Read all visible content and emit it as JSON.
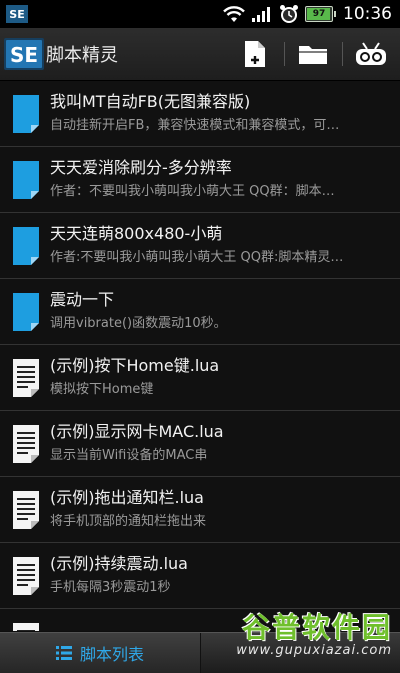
{
  "status_bar": {
    "time": "10:36",
    "battery": "97",
    "battery_level": 0.97
  },
  "action_bar": {
    "logo_text": "SE",
    "title": "脚本精灵",
    "icons": [
      "new-file-icon",
      "folder-icon",
      "gamepad-icon"
    ]
  },
  "scripts": [
    {
      "title": "我叫MT自动FB(无图兼容版)",
      "desc": "自动挂新开启FB，兼容快速模式和兼容模式，可…",
      "icon": "blue-file-icon"
    },
    {
      "title": "天天爱消除刷分-多分辨率",
      "desc": "作者：不要叫我小萌叫我小萌大王 QQ群：脚本…",
      "icon": "blue-file-icon"
    },
    {
      "title": "天天连萌800x480-小萌",
      "desc": "作者:不要叫我小萌叫我小萌大王 QQ群:脚本精灵…",
      "icon": "blue-file-icon"
    },
    {
      "title": "震动一下",
      "desc": "调用vibrate()函数震动10秒。",
      "icon": "blue-file-icon"
    },
    {
      "title": "(示例)按下Home键.lua",
      "desc": "模拟按下Home键",
      "icon": "text-file-icon"
    },
    {
      "title": "(示例)显示网卡MAC.lua",
      "desc": "显示当前Wifi设备的MAC串",
      "icon": "text-file-icon"
    },
    {
      "title": "(示例)拖出通知栏.lua",
      "desc": "将手机顶部的通知栏拖出来",
      "icon": "text-file-icon"
    },
    {
      "title": "(示例)持续震动.lua",
      "desc": "手机每隔3秒震动1秒",
      "icon": "text-file-icon"
    },
    {
      "title": "hchd",
      "desc": "",
      "icon": "text-file-icon"
    }
  ],
  "bottom_bar": {
    "tab_label": "脚本列表"
  },
  "watermark": {
    "main": "谷普软件园",
    "url": "www.gupuxiazai.com"
  },
  "colors": {
    "accent": "#2fa8e8",
    "blue_file": "#1e9ee0",
    "watermark_green": "#6fbf2c"
  }
}
